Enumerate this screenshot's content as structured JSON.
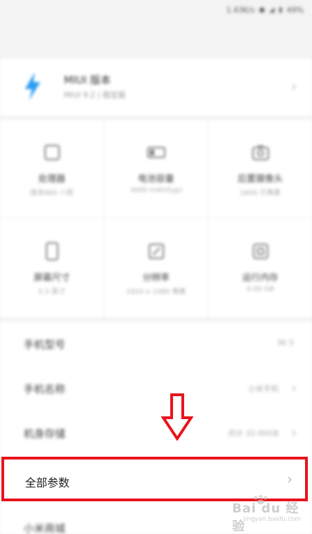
{
  "status_bar": {
    "text": "1.43K/s",
    "battery": "49%"
  },
  "miui": {
    "title": "MIUI 版本",
    "subtitle": "MIUI 9.2 | 稳定版"
  },
  "specs": [
    {
      "icon": "cpu-icon",
      "label": "处理器",
      "value": "骁龙660 八核"
    },
    {
      "icon": "battery-icon",
      "label": "电池容量",
      "value": "3000 mAh(typ)"
    },
    {
      "icon": "camera-icon",
      "label": "后置摄像头",
      "value": "1600 万像素"
    },
    {
      "icon": "phone-screen-icon",
      "label": "屏幕尺寸",
      "value": "5.5 英寸"
    },
    {
      "icon": "resolution-icon",
      "label": "分辨率",
      "value": "1920 x 1080 像素"
    },
    {
      "icon": "memory-icon",
      "label": "运行内存",
      "value": "4.00 GB"
    }
  ],
  "list": {
    "rows": [
      {
        "label": "手机型号",
        "value": "Mi 5",
        "chevron": false
      },
      {
        "label": "手机名称",
        "value": "小米手机",
        "chevron": true
      },
      {
        "label": "机身存储",
        "value": "共计 32.00GB",
        "chevron": true
      }
    ],
    "highlight_label": "全部参数",
    "bottom_label": "小米商城"
  },
  "watermark": {
    "brand": "Bai du 经验",
    "sub": "jingyan.baidu.com"
  },
  "colors": {
    "highlight": "#e8141c",
    "miui_logo": "#2b9cf2"
  }
}
